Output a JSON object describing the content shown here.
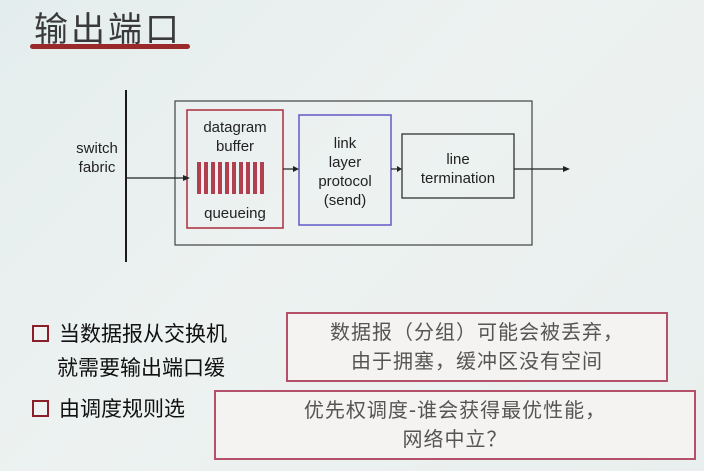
{
  "slide": {
    "title": "输出端口"
  },
  "diagram": {
    "switch_fabric": "switch\nfabric",
    "buffer_top": "datagram\nbuffer",
    "buffer_bottom": "queueing",
    "link_layer": "link\nlayer\nprotocol\n(send)",
    "line_termination": "line\ntermination",
    "colors": {
      "buffer_border": "#b03a48",
      "link_border": "#6a63c8",
      "queue_bars": "#b04050"
    }
  },
  "bullets": [
    {
      "line1": "当数据报从交换机",
      "line2": "就需要输出端口缓"
    },
    {
      "line1": "由调度规则选"
    }
  ],
  "overlays": [
    {
      "line1": "数据报（分组）可能会被丢弃，",
      "line2": "由于拥塞，缓冲区没有空间"
    },
    {
      "line1": "优先权调度-谁会获得最优性能，",
      "line2": "网络中立？"
    }
  ]
}
